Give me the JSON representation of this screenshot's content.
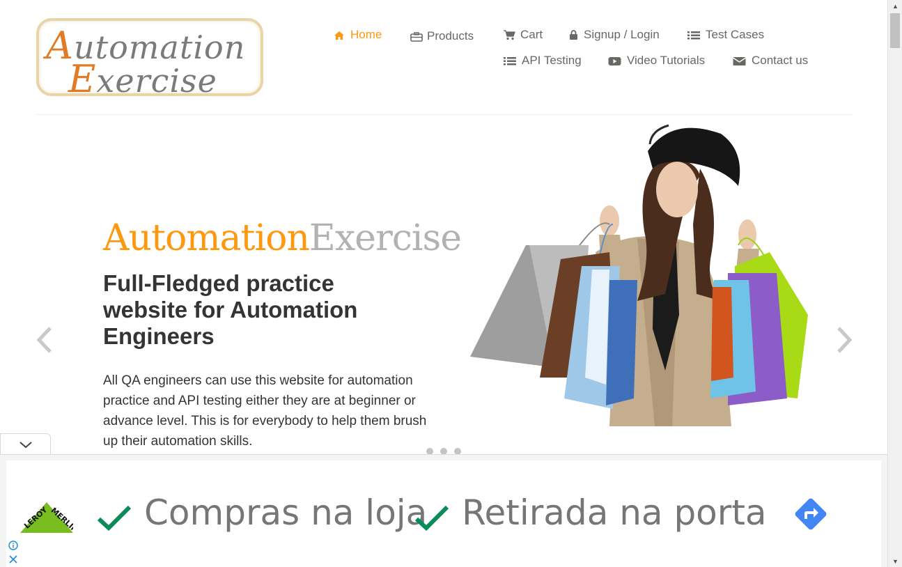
{
  "logo": {
    "line1": "utomation",
    "line1_cap": "A",
    "line2": "xercise",
    "line2_cap": "E"
  },
  "nav": {
    "home": "Home",
    "products": "Products",
    "cart": "Cart",
    "signup_login": "Signup / Login",
    "test_cases": "Test Cases",
    "api_testing": "API Testing",
    "video_tutorials": "Video Tutorials",
    "contact_us": "Contact us"
  },
  "slider": {
    "brand_a": "Automation",
    "brand_b": "Exercise",
    "headline": "Full-Fledged practice website for Automation Engineers",
    "description": "All QA engineers can use this website for automation practice and API testing either they are at beginner or advance level. This is for everybody to help them brush up their automation skills.",
    "active_slide": 1,
    "slide_count": 3
  },
  "ad": {
    "brand_logo_text": "LEROY MERLIN",
    "item1": "Compras na loja",
    "item2": "Retirada na porta"
  },
  "colors": {
    "accent": "#FE980F",
    "text": "#696763",
    "heading": "#363432",
    "check_green": "#0b8a5a",
    "direction_blue": "#4285f4",
    "leroy_green": "#78be20"
  },
  "icons": {
    "home": "home-icon",
    "products": "briefcase-icon",
    "cart": "shopping-cart-icon",
    "signup": "lock-icon",
    "test_cases": "list-icon",
    "api": "list-icon",
    "video": "youtube-play-icon",
    "contact": "envelope-icon"
  }
}
